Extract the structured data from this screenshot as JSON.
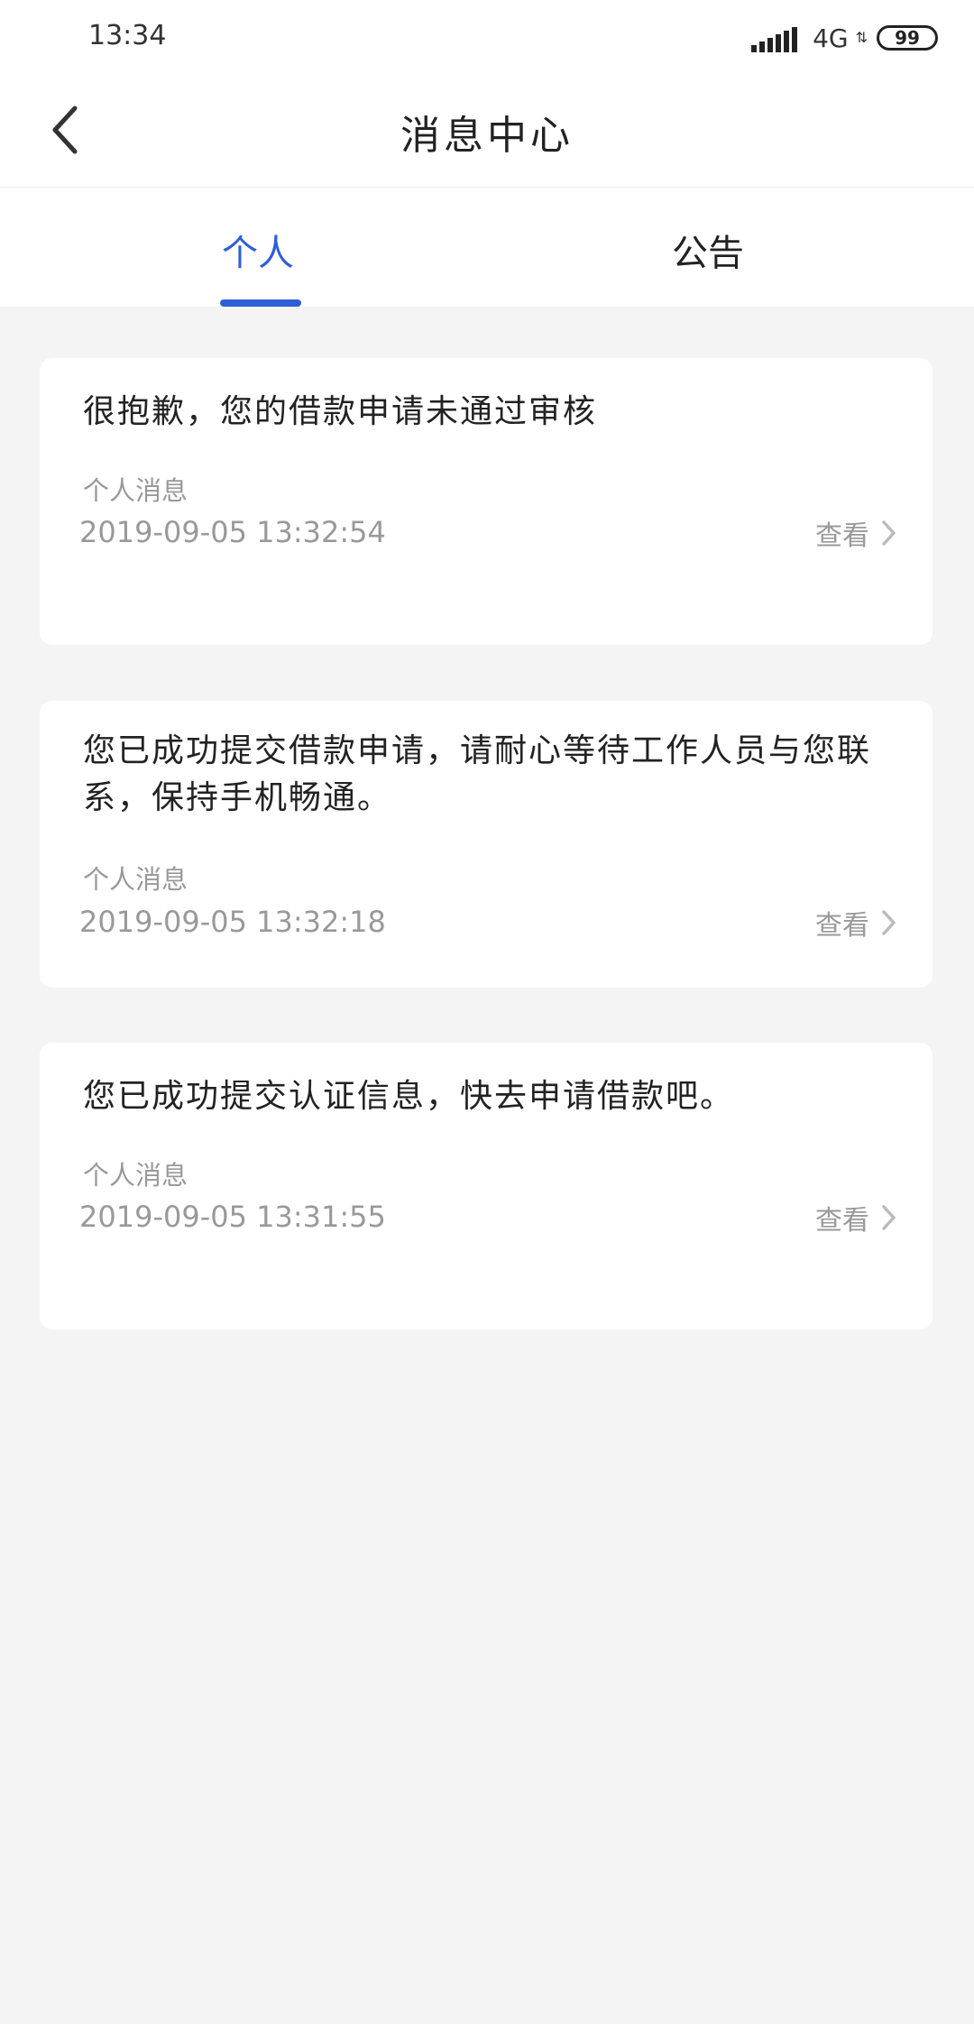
{
  "status_bar": {
    "time": "13:34",
    "network": "4G",
    "battery": "99"
  },
  "nav": {
    "title": "消息中心"
  },
  "tabs": [
    {
      "label": "个人",
      "active": true
    },
    {
      "label": "公告",
      "active": false
    }
  ],
  "accent_color": "#2f5fd8",
  "messages": [
    {
      "title": "很抱歉，您的借款申请未通过审核",
      "category": "个人消息",
      "time": "2019-09-05 13:32:54",
      "action": "查看"
    },
    {
      "title": "您已成功提交借款申请，请耐心等待工作人员与您联系，保持手机畅通。",
      "category": "个人消息",
      "time": "2019-09-05 13:32:18",
      "action": "查看"
    },
    {
      "title": "您已成功提交认证信息，快去申请借款吧。",
      "category": "个人消息",
      "time": "2019-09-05 13:31:55",
      "action": "查看"
    }
  ]
}
